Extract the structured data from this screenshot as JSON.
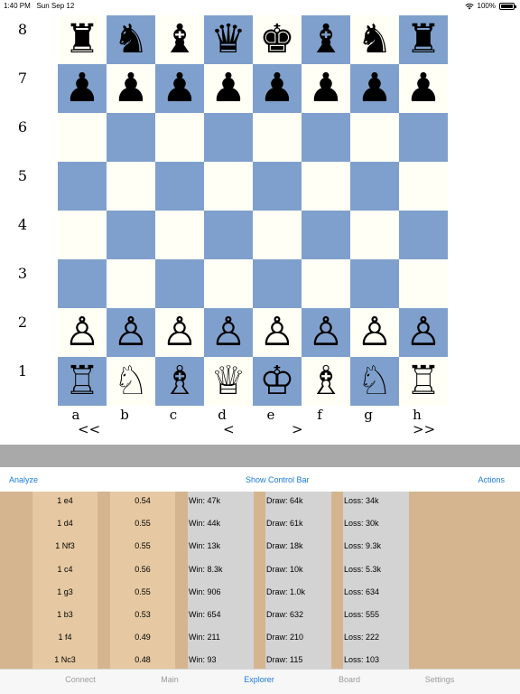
{
  "status_bar": {
    "time": "1:40 PM",
    "date": "Sun Sep 12",
    "battery": "100%"
  },
  "board": {
    "ranks": [
      "8",
      "7",
      "6",
      "5",
      "4",
      "3",
      "2",
      "1"
    ],
    "files": [
      "a",
      "b",
      "c",
      "d",
      "e",
      "f",
      "g",
      "h"
    ],
    "position": [
      [
        "♜",
        "♞",
        "♝",
        "♛",
        "♚",
        "♝",
        "♞",
        "♜"
      ],
      [
        "♟",
        "♟",
        "♟",
        "♟",
        "♟",
        "♟",
        "♟",
        "♟"
      ],
      [
        "",
        "",
        "",
        "",
        "",
        "",
        "",
        ""
      ],
      [
        "",
        "",
        "",
        "",
        "",
        "",
        "",
        ""
      ],
      [
        "",
        "",
        "",
        "",
        "",
        "",
        "",
        ""
      ],
      [
        "",
        "",
        "",
        "",
        "",
        "",
        "",
        ""
      ],
      [
        "♙",
        "♙",
        "♙",
        "♙",
        "♙",
        "♙",
        "♙",
        "♙"
      ],
      [
        "♖",
        "♘",
        "♗",
        "♕",
        "♔",
        "♗",
        "♘",
        "♖"
      ]
    ],
    "light_color": "#fffff6",
    "dark_color": "#7fa0cc"
  },
  "navigation": {
    "first": "<<",
    "prev": "<",
    "next": ">",
    "last": ">>"
  },
  "actions": {
    "analyze": "Analyze",
    "show_control_bar": "Show Control Bar",
    "actions": "Actions"
  },
  "explorer": {
    "rows": [
      {
        "move": "1 e4",
        "score": "0.54",
        "win": "Win: 47k",
        "draw": "Draw: 64k",
        "loss": "Loss: 34k"
      },
      {
        "move": "1 d4",
        "score": "0.55",
        "win": "Win: 44k",
        "draw": "Draw: 61k",
        "loss": "Loss: 30k"
      },
      {
        "move": "1 Nf3",
        "score": "0.55",
        "win": "Win: 13k",
        "draw": "Draw: 18k",
        "loss": "Loss: 9.3k"
      },
      {
        "move": "1 c4",
        "score": "0.56",
        "win": "Win: 8.3k",
        "draw": "Draw: 10k",
        "loss": "Loss: 5.3k"
      },
      {
        "move": "1 g3",
        "score": "0.55",
        "win": "Win: 906",
        "draw": "Draw: 1.0k",
        "loss": "Loss: 634"
      },
      {
        "move": "1 b3",
        "score": "0.53",
        "win": "Win: 654",
        "draw": "Draw: 632",
        "loss": "Loss: 555"
      },
      {
        "move": "1 f4",
        "score": "0.49",
        "win": "Win: 211",
        "draw": "Draw: 210",
        "loss": "Loss: 222"
      },
      {
        "move": "1 Nc3",
        "score": "0.48",
        "win": "Win: 93",
        "draw": "Draw: 115",
        "loss": "Loss: 103"
      }
    ]
  },
  "tabs": [
    {
      "label": "Connect",
      "active": false
    },
    {
      "label": "Main",
      "active": false
    },
    {
      "label": "Explorer",
      "active": true
    },
    {
      "label": "Board",
      "active": false
    },
    {
      "label": "Settings",
      "active": false
    }
  ],
  "colors": {
    "accent": "#1b7be0",
    "explorer_bg": "#d4b58f",
    "light_col": "#e6c9a2",
    "grey_col": "#d3d3d3"
  }
}
